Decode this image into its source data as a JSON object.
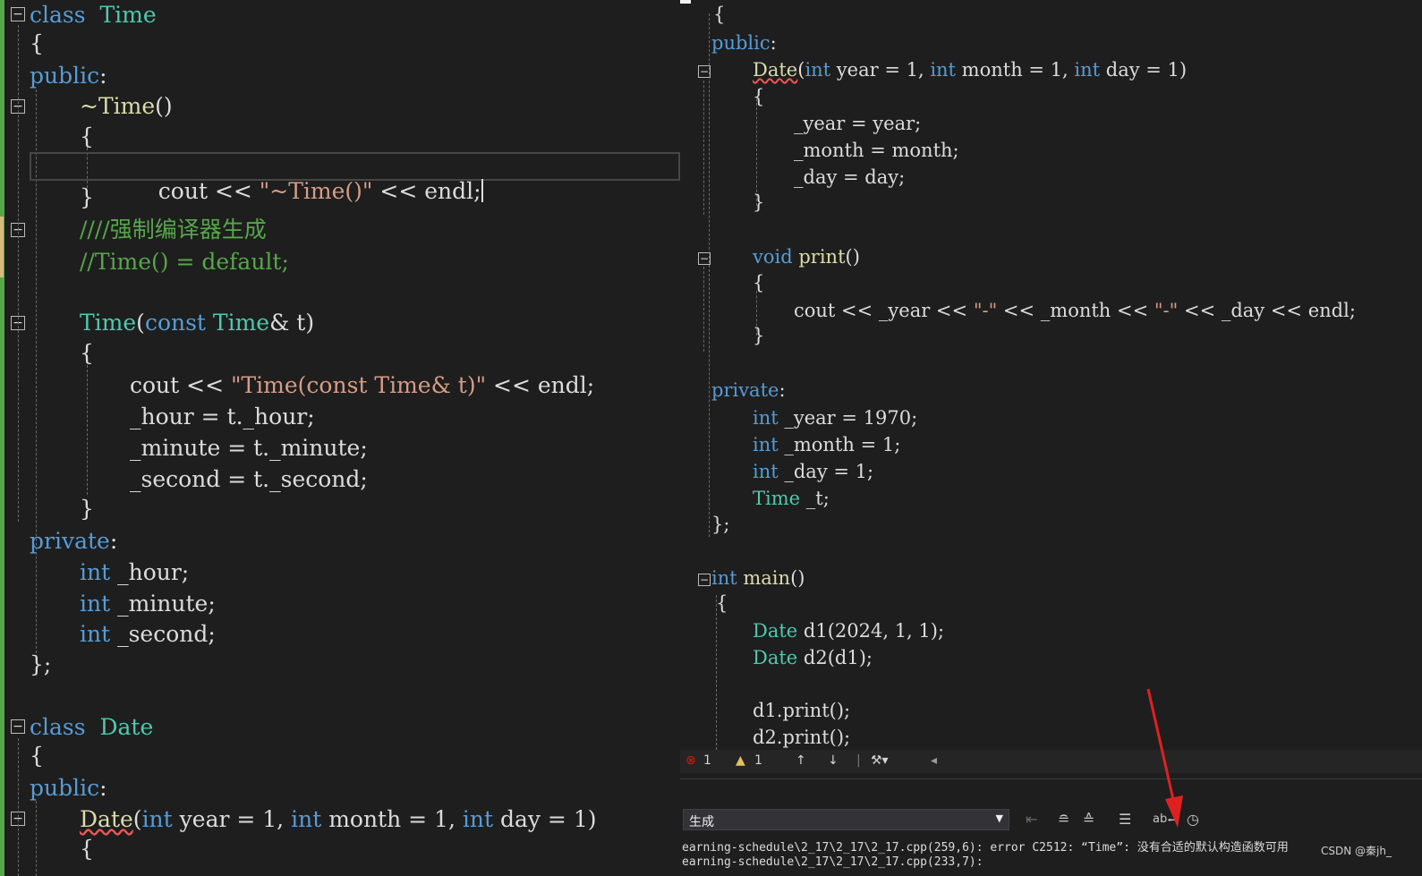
{
  "left_editor": {
    "lines": {
      "l1": [
        [
          "kw",
          "class"
        ],
        [
          "",
          "  "
        ],
        [
          "ty",
          "Time"
        ]
      ],
      "l2": [
        [
          "",
          "{"
        ]
      ],
      "l3": [
        [
          "kw",
          "public"
        ],
        [
          "",
          ":"
        ]
      ],
      "l4": [
        [
          "fn",
          "~Time"
        ],
        [
          "",
          "()"
        ]
      ],
      "l5": [
        [
          "",
          "{"
        ]
      ],
      "l6": [
        [
          "",
          "cout << "
        ],
        [
          "str",
          "\"~Time()\""
        ],
        [
          "",
          " << endl;"
        ]
      ],
      "l7": [
        [
          "",
          "}"
        ]
      ],
      "l8": [
        [
          "cm",
          "////强制编译器生成"
        ]
      ],
      "l9": [
        [
          "cm",
          "//Time() = default;"
        ]
      ],
      "l10": [
        [
          "ty",
          "Time"
        ],
        [
          "",
          "("
        ],
        [
          "kw",
          "const"
        ],
        [
          "",
          " "
        ],
        [
          "ty",
          "Time"
        ],
        [
          "",
          "& t)"
        ]
      ],
      "l11": [
        [
          "",
          "{"
        ]
      ],
      "l12": [
        [
          "",
          "cout << "
        ],
        [
          "str",
          "\"Time(const Time& t)\""
        ],
        [
          "",
          " << endl;"
        ]
      ],
      "l13": [
        [
          "",
          "_hour = t._hour;"
        ]
      ],
      "l14": [
        [
          "",
          "_minute = t._minute;"
        ]
      ],
      "l15": [
        [
          "",
          "_second = t._second;"
        ]
      ],
      "l16": [
        [
          "",
          "}"
        ]
      ],
      "l17": [
        [
          "kw",
          "private"
        ],
        [
          "",
          ":"
        ]
      ],
      "l18": [
        [
          "kw",
          "int"
        ],
        [
          "",
          " _hour;"
        ]
      ],
      "l19": [
        [
          "kw",
          "int"
        ],
        [
          "",
          " _minute;"
        ]
      ],
      "l20": [
        [
          "kw",
          "int"
        ],
        [
          "",
          " _second;"
        ]
      ],
      "l21": [
        [
          "",
          "};"
        ]
      ],
      "l22": [
        [
          "kw",
          "class"
        ],
        [
          "",
          "  "
        ],
        [
          "ty",
          "Date"
        ]
      ],
      "l23": [
        [
          "",
          "{"
        ]
      ],
      "l24": [
        [
          "kw",
          "public"
        ],
        [
          "",
          ":"
        ]
      ],
      "l25": [
        [
          "fn",
          "Date"
        ],
        [
          "",
          "("
        ],
        [
          "kw",
          "int"
        ],
        [
          "",
          " year = 1, "
        ],
        [
          "kw",
          "int"
        ],
        [
          "",
          " month = 1, "
        ],
        [
          "kw",
          "int"
        ],
        [
          "",
          " day = 1)"
        ]
      ],
      "l26": [
        [
          "",
          "{"
        ]
      ]
    }
  },
  "right_editor": {
    "lines": {
      "r1": [
        [
          "",
          "{"
        ]
      ],
      "r2": [
        [
          "kw",
          "public"
        ],
        [
          "",
          ":"
        ]
      ],
      "r3": [
        [
          "fn",
          "Date"
        ],
        [
          "",
          "("
        ],
        [
          "kw",
          "int"
        ],
        [
          "",
          " year = 1, "
        ],
        [
          "kw",
          "int"
        ],
        [
          "",
          " month = 1, "
        ],
        [
          "kw",
          "int"
        ],
        [
          "",
          " day = 1)"
        ]
      ],
      "r4": [
        [
          "",
          "{"
        ]
      ],
      "r5": [
        [
          "",
          "_year = year;"
        ]
      ],
      "r6": [
        [
          "",
          "_month = month;"
        ]
      ],
      "r7": [
        [
          "",
          "_day = day;"
        ]
      ],
      "r8": [
        [
          "",
          "}"
        ]
      ],
      "r9": [
        [
          "kw",
          "void"
        ],
        [
          "",
          " "
        ],
        [
          "fn",
          "print"
        ],
        [
          "",
          "()"
        ]
      ],
      "r10": [
        [
          "",
          "{"
        ]
      ],
      "r11": [
        [
          "",
          "cout << _year << "
        ],
        [
          "str",
          "\"-\""
        ],
        [
          "",
          " << _month << "
        ],
        [
          "str",
          "\"-\""
        ],
        [
          "",
          " << _day << endl;"
        ]
      ],
      "r12": [
        [
          "",
          "}"
        ]
      ],
      "r13": [
        [
          "kw",
          "private"
        ],
        [
          "",
          ":"
        ]
      ],
      "r14": [
        [
          "kw",
          "int"
        ],
        [
          "",
          " _year = 1970;"
        ]
      ],
      "r15": [
        [
          "kw",
          "int"
        ],
        [
          "",
          " _month = 1;"
        ]
      ],
      "r16": [
        [
          "kw",
          "int"
        ],
        [
          "",
          " _day = 1;"
        ]
      ],
      "r17": [
        [
          "ty",
          "Time"
        ],
        [
          "",
          " _t;"
        ]
      ],
      "r18": [
        [
          "",
          "};"
        ]
      ],
      "r19": [
        [
          "kw",
          "int"
        ],
        [
          "",
          " "
        ],
        [
          "fn",
          "main"
        ],
        [
          "",
          "()"
        ]
      ],
      "r20": [
        [
          "",
          "{"
        ]
      ],
      "r21": [
        [
          "ty",
          "Date"
        ],
        [
          "",
          " d1(2024, 1, 1);"
        ]
      ],
      "r22": [
        [
          "ty",
          "Date"
        ],
        [
          "",
          " d2(d1);"
        ]
      ],
      "r23": [
        [
          "",
          "d1.print();"
        ]
      ],
      "r24": [
        [
          "",
          "d2.print();"
        ]
      ]
    }
  },
  "fold_glyph": "−",
  "error_list": {
    "error_icon": "x-circle-icon",
    "error_count": "1",
    "warning_icon": "warning-icon",
    "warning_count": "1",
    "up_glyph": "↑",
    "down_glyph": "↓",
    "brush_glyph": "⚒▾",
    "left_glyph": "◂"
  },
  "output": {
    "source_label": "生成",
    "lines": [
      "earning-schedule\\2_17\\2_17\\2_17.cpp(259,6): error C2512: “Time”: 没有合适的默认构造函数可用",
      "earning-schedule\\2_17\\2_17\\2_17.cpp(233,7):"
    ]
  },
  "watermark": "CSDN @秦jh_",
  "colors": {
    "keyword": "#569cd6",
    "type": "#4ec9b0",
    "string": "#d69d85",
    "comment": "#57a64a",
    "annotation_arrow": "#e02020"
  }
}
